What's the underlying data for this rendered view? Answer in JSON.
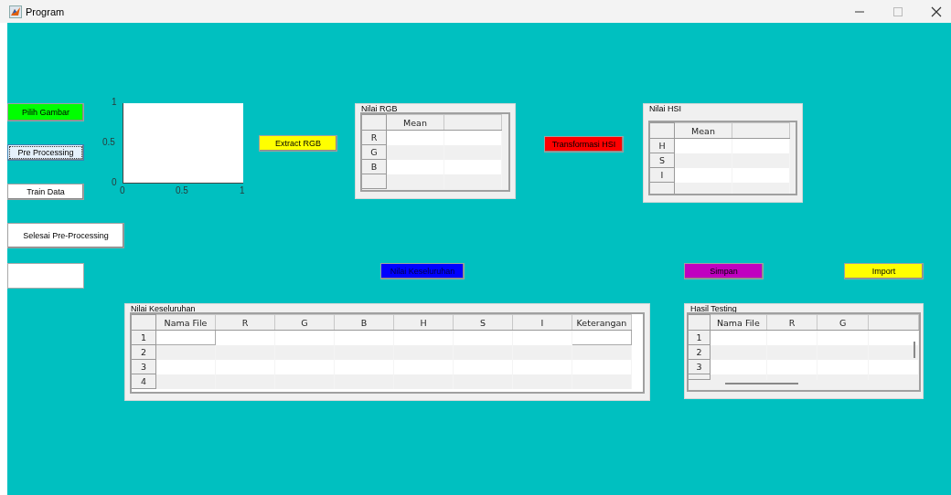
{
  "window": {
    "title": "Program"
  },
  "side_buttons": [
    {
      "label": "Pilih Gambar",
      "color": "#00ff00",
      "focused": false
    },
    {
      "label": "Pre Processing",
      "color": "#e5f1fb",
      "focused": true
    },
    {
      "label": "Train Data",
      "color": "#ffffff",
      "focused": false
    },
    {
      "label": "Selesai Pre-Processing",
      "color": "#ffffff",
      "focused": false
    }
  ],
  "axes": {
    "yticks": [
      "1",
      "0.5",
      "0"
    ],
    "xticks": [
      "0",
      "0.5",
      "1"
    ]
  },
  "extract_button": {
    "label": "Extract RGB",
    "color": "#ffff00"
  },
  "rgb_panel": {
    "title": "Nilai RGB",
    "columns": [
      "Mean"
    ],
    "rows": [
      "R",
      "G",
      "B"
    ]
  },
  "hsi_button": {
    "label": "Transformasi HSI",
    "color": "#ff0000"
  },
  "hsi_panel": {
    "title": "Nilai HSI",
    "columns": [
      "Mean"
    ],
    "rows": [
      "H",
      "S",
      "I"
    ]
  },
  "action_buttons": [
    {
      "label": "Nilai Keseluruhan",
      "color": "#0000ff"
    },
    {
      "label": "Simpan",
      "color": "#c000c0"
    },
    {
      "label": "Import",
      "color": "#ffff00"
    }
  ],
  "overall_panel": {
    "title": "Nilai Keseluruhan",
    "columns": [
      "Nama File",
      "R",
      "G",
      "B",
      "H",
      "S",
      "I",
      "Keterangan"
    ],
    "rows": [
      "1",
      "2",
      "3",
      "4"
    ]
  },
  "testing_panel": {
    "title": "Hasil Testing",
    "columns": [
      "Nama File",
      "R",
      "G"
    ],
    "rows": [
      "1",
      "2",
      "3"
    ]
  }
}
